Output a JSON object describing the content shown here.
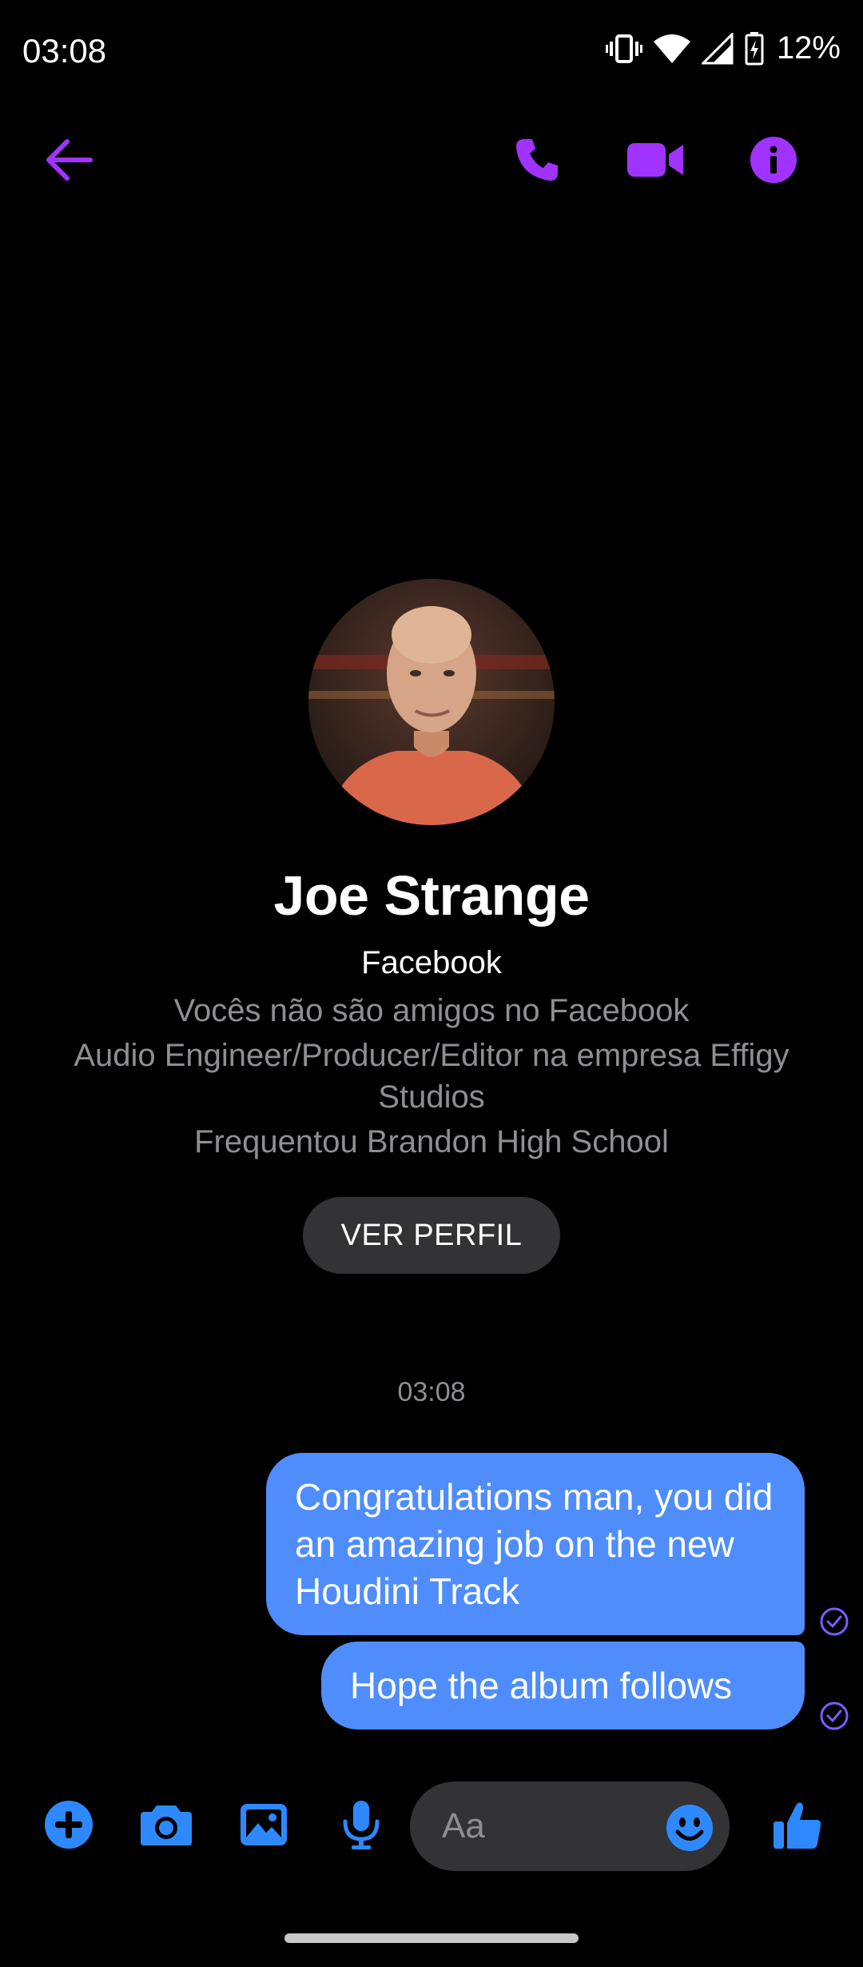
{
  "status_bar": {
    "time": "03:08",
    "battery_percent": "12%",
    "icons": [
      "vibrate-icon",
      "wifi-icon",
      "cell-signal-icon",
      "battery-charging-icon"
    ]
  },
  "app_bar": {
    "icons": [
      "back-arrow-icon",
      "phone-icon",
      "video-camera-icon",
      "info-icon"
    ],
    "accent_color": "#a033ff"
  },
  "profile": {
    "name": "Joe Strange",
    "source": "Facebook",
    "friends_status": "Vocês não são amigos no Facebook",
    "work": "Audio Engineer/Producer/Editor na empresa Effigy Studios",
    "school": "Frequentou Brandon High School",
    "view_profile_label": "VER PERFIL"
  },
  "conversation": {
    "timestamp": "03:08",
    "messages": [
      {
        "text": "Congratulations man, you did an amazing job on the new Houdini Track",
        "status": "read"
      },
      {
        "text": "Hope the album follows",
        "status": "read"
      }
    ],
    "bubble_color": "#4f8dfc",
    "status_color": "#7b5cff"
  },
  "composer": {
    "placeholder": "Aa",
    "icons": [
      "plus-icon",
      "camera-icon",
      "gallery-icon",
      "microphone-icon",
      "emoji-icon",
      "thumbs-up-icon"
    ],
    "icon_color": "#2e89ff"
  }
}
